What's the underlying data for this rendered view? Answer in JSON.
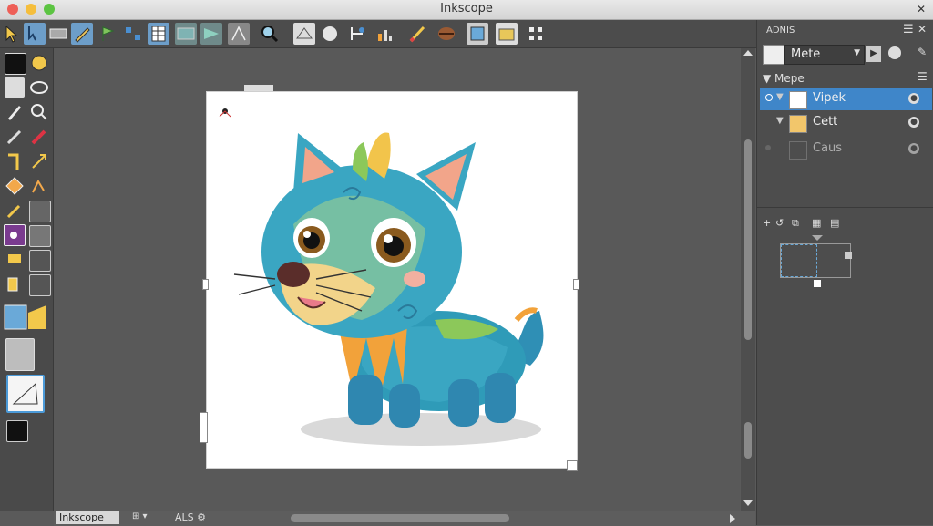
{
  "window": {
    "title": "Inkscope"
  },
  "panel": {
    "header": "ADNIS",
    "dropdown_value": "Mete",
    "section_title": "Mepe",
    "layers": [
      {
        "name": "Vipek",
        "selected": true,
        "color": "#ffffff"
      },
      {
        "name": "Cett",
        "selected": false,
        "color": "#f2c66b"
      },
      {
        "name": "Caus",
        "selected": false,
        "color": "#4d4d4d"
      }
    ]
  },
  "status": {
    "app": "Inkscope",
    "field1": "ALS"
  },
  "colors": {
    "accent": "#3f86c9",
    "canvas_bg": "#595959"
  },
  "icons": [
    "selector-icon",
    "node-icon",
    "zoom-icon",
    "pencil-icon",
    "pen-icon",
    "rect-icon",
    "ellipse-icon",
    "text-icon",
    "gradient-icon",
    "dropper-icon",
    "spray-icon",
    "eraser-icon",
    "bucket-icon"
  ]
}
